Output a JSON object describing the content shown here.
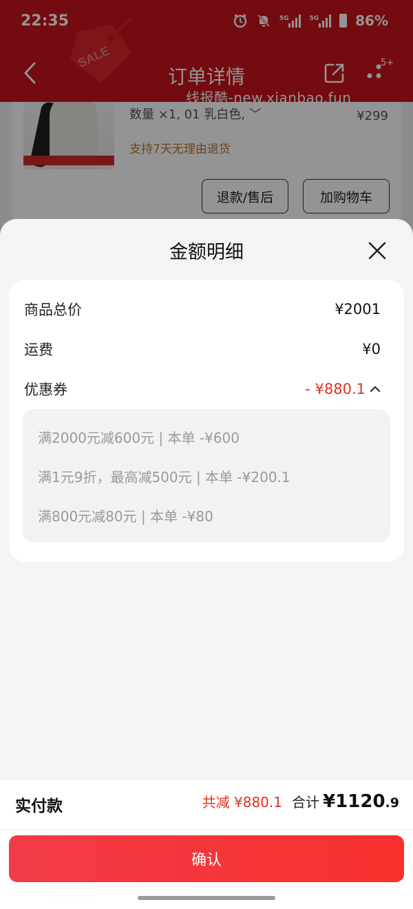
{
  "status_bar": {
    "time": "22:35",
    "network_1": "5G",
    "network_2": "5G",
    "battery": "86%",
    "icons": [
      "alarm-icon",
      "mute-icon",
      "signal-icon",
      "signal-icon",
      "battery-icon"
    ]
  },
  "nav": {
    "title": "订单详情",
    "badge": "5+",
    "sale_tag": "SALE",
    "watermark": "线报酷-new.xianbao.fun"
  },
  "product": {
    "qty_spec": "数量 ×1, 01 乳白色, ﹀",
    "price": "¥299",
    "return_policy": "支持7天无理由退货",
    "refund_button": "退款/售后",
    "cart_button": "加购物车"
  },
  "sheet": {
    "title": "金额明细",
    "rows": {
      "total_label": "商品总价",
      "total_value": "¥2001",
      "shipping_label": "运费",
      "shipping_value": "¥0",
      "coupon_label": "优惠券",
      "coupon_value": "- ¥880.1"
    },
    "coupons": [
      "满2000元减600元 | 本单 -¥600",
      "满1元9折，最高减500元 | 本单 -¥200.1",
      "满800元减80元 | 本单 -¥80"
    ]
  },
  "footer": {
    "pay_label": "实付款",
    "reduce_text": "共减 ¥880.1",
    "sum_label": "合计",
    "sum_integer": "¥1120",
    "sum_decimal": ".9",
    "confirm_button": "确认"
  },
  "colors": {
    "nav_red": "#c8141c",
    "accent_red": "#e0321e",
    "confirm_gradient_start": "#f23b48",
    "confirm_gradient_end": "#f7302c",
    "return_text": "#b87432"
  }
}
